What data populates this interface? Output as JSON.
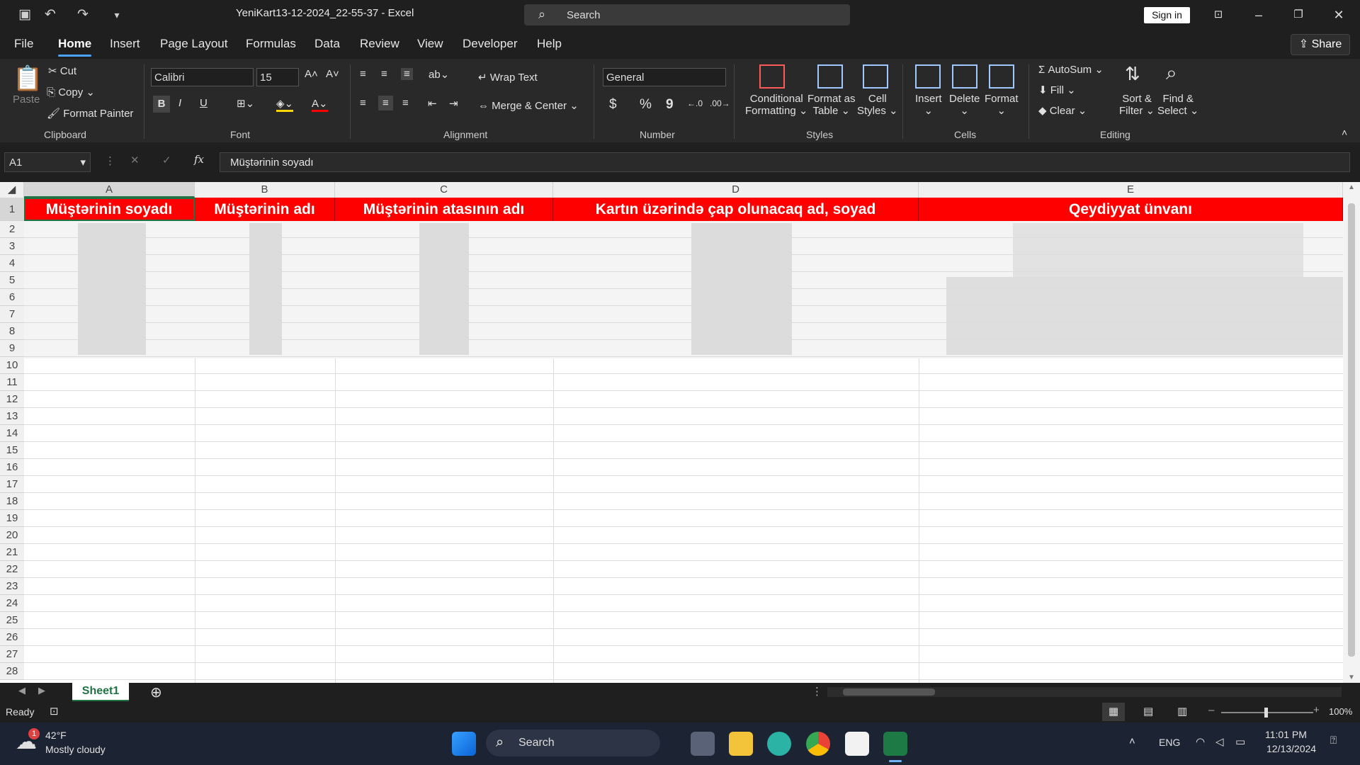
{
  "titlebar": {
    "doc_title": "YeniKart13-12-2024_22-55-37  -  Excel",
    "search_label": "Search",
    "signin_label": "Sign in"
  },
  "menu": {
    "tabs": [
      "File",
      "Home",
      "Insert",
      "Page Layout",
      "Formulas",
      "Data",
      "Review",
      "View",
      "Developer",
      "Help"
    ],
    "active": "Home",
    "share_label": "Share"
  },
  "ribbon": {
    "clipboard": {
      "paste": "Paste",
      "cut": "Cut",
      "copy": "Copy",
      "format_painter": "Format Painter",
      "label": "Clipboard"
    },
    "font": {
      "name": "Calibri",
      "size": "15",
      "label": "Font",
      "bold": "B",
      "italic": "I",
      "underline": "U"
    },
    "alignment": {
      "wrap": "Wrap Text",
      "merge": "Merge & Center",
      "label": "Alignment"
    },
    "number": {
      "format": "General",
      "label": "Number",
      "currency": "$",
      "percent": "%",
      "comma": "9"
    },
    "styles": {
      "conditional": "Conditional",
      "conditional2": "Formatting",
      "format_table": "Format as",
      "format_table2": "Table",
      "cell_styles": "Cell",
      "cell_styles2": "Styles",
      "label": "Styles"
    },
    "cells": {
      "insert": "Insert",
      "delete": "Delete",
      "format": "Format",
      "label": "Cells"
    },
    "editing": {
      "autosum": "AutoSum",
      "fill": "Fill",
      "clear": "Clear",
      "sort": "Sort &",
      "sort2": "Filter",
      "find": "Find &",
      "find2": "Select",
      "label": "Editing"
    }
  },
  "formula_bar": {
    "namebox": "A1",
    "fx": "fx",
    "content": "Müştərinin soyadı"
  },
  "sheet": {
    "columns": [
      "A",
      "B",
      "C",
      "D",
      "E"
    ],
    "selected_column": "A",
    "headers": [
      "Müştərinin soyadı",
      "Müştərinin adı",
      "Müştərinin atasının adı",
      "Kartın üzərində çap olunacaq ad, soyad",
      "Qeydiyyat ünvanı"
    ],
    "rows": [
      "1",
      "2",
      "3",
      "4",
      "5",
      "6",
      "7",
      "8",
      "9",
      "10",
      "11",
      "12",
      "13",
      "14",
      "15",
      "16",
      "17",
      "18",
      "19",
      "20",
      "21",
      "22",
      "23",
      "24",
      "25",
      "26",
      "27",
      "28"
    ],
    "header_color": "#ff0000",
    "tab_name": "Sheet1"
  },
  "status": {
    "ready": "Ready",
    "zoom": "100%"
  },
  "taskbar": {
    "weather_temp": "42°F",
    "weather_desc": "Mostly cloudy",
    "weather_badge": "1",
    "search_label": "Search",
    "lang": "ENG",
    "time": "11:01 PM",
    "date": "12/13/2024"
  }
}
